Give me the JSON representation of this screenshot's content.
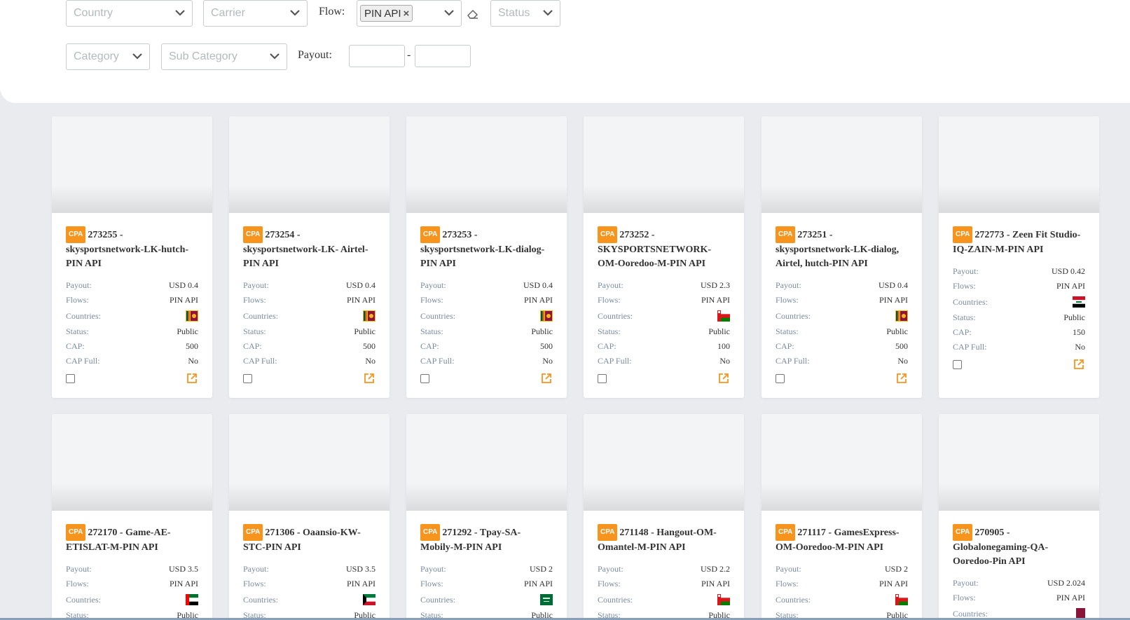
{
  "filters": {
    "country_placeholder": "Country",
    "carrier_placeholder": "Carrier",
    "flow_label": "Flow:",
    "flow_tag": "PIN API",
    "flow_tag_remove": "×",
    "status_placeholder": "Status",
    "category_placeholder": "Category",
    "subcategory_placeholder": "Sub Category",
    "payout_label": "Payout:",
    "payout_separator": "-"
  },
  "labels": {
    "badge": "CPA",
    "payout": "Payout:",
    "flows": "Flows:",
    "countries": "Countries:",
    "status": "Status:",
    "cap": "CAP:",
    "cap_full": "CAP Full:"
  },
  "colors": {
    "badge": "#f7941d",
    "accent_icon": "#f7941d"
  },
  "offers": [
    {
      "title": "273255 - skysportsnetwork-LK-hutch-PIN API",
      "payout": "USD 0.4",
      "flows": "PIN API",
      "country_flag": "sri-lanka-flag",
      "status": "Public",
      "cap": "500",
      "cap_full": "No"
    },
    {
      "title": "273254 - skysportsnetwork-LK- Airtel-PIN API",
      "payout": "USD 0.4",
      "flows": "PIN API",
      "country_flag": "sri-lanka-flag",
      "status": "Public",
      "cap": "500",
      "cap_full": "No"
    },
    {
      "title": "273253 - skysportsnetwork-LK-dialog-PIN API",
      "payout": "USD 0.4",
      "flows": "PIN API",
      "country_flag": "sri-lanka-flag",
      "status": "Public",
      "cap": "500",
      "cap_full": "No"
    },
    {
      "title": "273252 - SKYSPORTSNETWORK-OM-Ooredoo-M-PIN API",
      "payout": "USD 2.3",
      "flows": "PIN API",
      "country_flag": "oman-flag",
      "status": "Public",
      "cap": "100",
      "cap_full": "No"
    },
    {
      "title": "273251 - skysportsnetwork-LK-dialog, Airtel, hutch-PIN API",
      "payout": "USD 0.4",
      "flows": "PIN API",
      "country_flag": "sri-lanka-flag",
      "status": "Public",
      "cap": "500",
      "cap_full": "No"
    },
    {
      "title": "272773 - Zeen Fit Studio-IQ-ZAIN-M-PIN API",
      "payout": "USD 0.42",
      "flows": "PIN API",
      "country_flag": "iraq-flag",
      "status": "Public",
      "cap": "150",
      "cap_full": "No"
    },
    {
      "title": "272170 - Game-AE-ETISLAT-M-PIN API",
      "payout": "USD 3.5",
      "flows": "PIN API",
      "country_flag": "uae-flag",
      "status": "Public"
    },
    {
      "title": "271306 - Oaansio-KW-STC-PIN API",
      "payout": "USD 3.5",
      "flows": "PIN API",
      "country_flag": "kuwait-flag",
      "status": "Public"
    },
    {
      "title": "271292 - Tpay-SA-Mobily-M-PIN API",
      "payout": "USD 2",
      "flows": "PIN API",
      "country_flag": "saudi-arabia-flag",
      "status": "Public"
    },
    {
      "title": "271148 - Hangout-OM-Omantel-M-PIN API",
      "payout": "USD 2.2",
      "flows": "PIN API",
      "country_flag": "oman-flag",
      "status": "Public"
    },
    {
      "title": "271117 - GamesExpress-OM-Ooredoo-M-PIN API",
      "payout": "USD 2",
      "flows": "PIN API",
      "country_flag": "oman-flag",
      "status": "Public"
    },
    {
      "title": "270905 - Globalonegaming-QA-Ooredoo-Pin API",
      "payout": "USD 2.024",
      "flows": "PIN API",
      "country_flag": "qatar-flag"
    }
  ]
}
